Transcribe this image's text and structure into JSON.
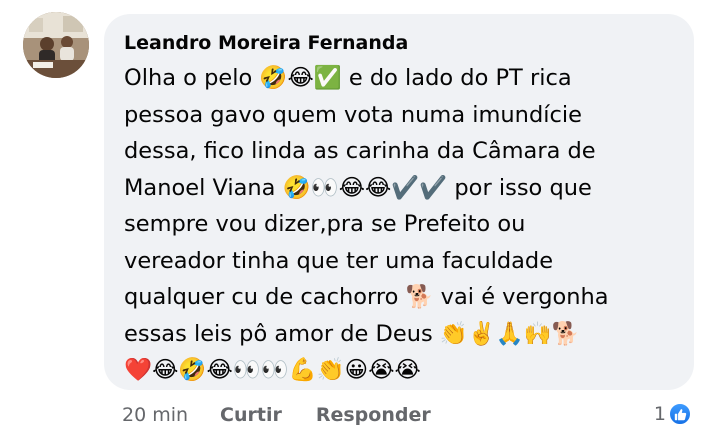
{
  "comment": {
    "author": "Leandro Moreira Fernanda",
    "lines": [
      "Olha o pelo 🤣😂✅ e do lado do PT rica",
      "pessoa gavo quem vota numa imundície",
      "dessa, fico linda as carinha da Câmara de",
      "Manoel Viana 🤣👀😂😂✔️✔️ por isso que",
      "sempre vou dizer,pra se Prefeito ou",
      "vereador tinha que ter uma faculdade",
      "qualquer cu de cachorro 🐕 vai é vergonha",
      "essas leis pô amor de Deus 👏✌️🙏🙌🐕",
      "❤️😂🤣😂👀👀💪👏😀😭😭"
    ],
    "timestamp": "20 min",
    "like_label": "Curtir",
    "reply_label": "Responder",
    "reaction_count": "1"
  },
  "colors": {
    "bubble": "#f0f2f5",
    "text": "#050505",
    "secondary": "#65676b",
    "like_blue": "#1877f2"
  },
  "icons": {
    "avatar": "profile-photo",
    "reaction": "thumbs-up-icon"
  }
}
